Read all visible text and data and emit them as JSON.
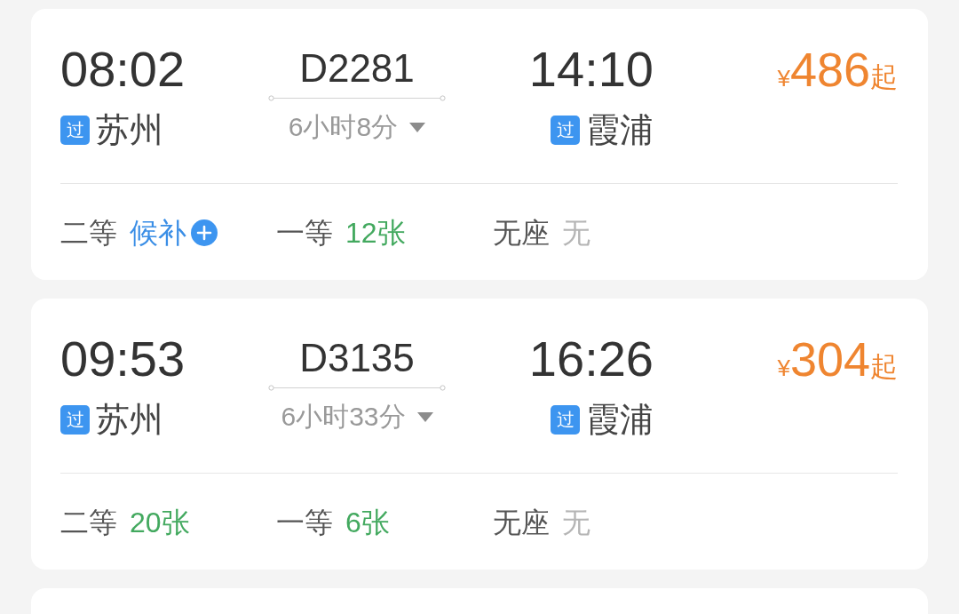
{
  "trains": [
    {
      "depart_time": "08:02",
      "depart_station": {
        "badge": "过",
        "name": "苏州"
      },
      "train_number": "D2281",
      "duration": "6小时8分",
      "arrive_time": "14:10",
      "arrive_station": {
        "badge": "过",
        "name": "霞浦"
      },
      "price": {
        "currency": "¥",
        "amount": "486",
        "suffix": "起"
      },
      "seats": [
        {
          "class": "二等",
          "availability": "候补",
          "kind": "waitlist"
        },
        {
          "class": "一等",
          "availability": "12张",
          "kind": "available"
        },
        {
          "class": "无座",
          "availability": "无",
          "kind": "none"
        }
      ]
    },
    {
      "depart_time": "09:53",
      "depart_station": {
        "badge": "过",
        "name": "苏州"
      },
      "train_number": "D3135",
      "duration": "6小时33分",
      "arrive_time": "16:26",
      "arrive_station": {
        "badge": "过",
        "name": "霞浦"
      },
      "price": {
        "currency": "¥",
        "amount": "304",
        "suffix": "起"
      },
      "seats": [
        {
          "class": "二等",
          "availability": "20张",
          "kind": "available"
        },
        {
          "class": "一等",
          "availability": "6张",
          "kind": "available"
        },
        {
          "class": "无座",
          "availability": "无",
          "kind": "none"
        }
      ]
    }
  ]
}
